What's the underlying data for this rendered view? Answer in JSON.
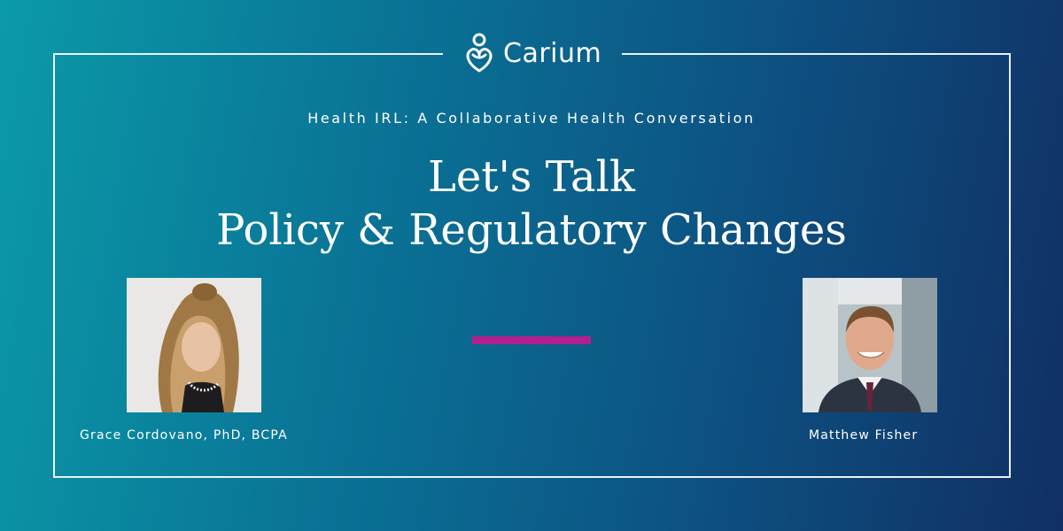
{
  "brand": {
    "name": "Carium",
    "icon": "carium-logo-icon"
  },
  "kicker": "Health IRL: A Collaborative Health Conversation",
  "headline": {
    "line1": "Let's Talk",
    "line2": "Policy & Regulatory Changes"
  },
  "speakers": [
    {
      "name": "Grace Cordovano, PhD, BCPA",
      "photo": "speaker-photo"
    },
    {
      "name": "Matthew Fisher",
      "photo": "speaker-photo"
    }
  ],
  "colors": {
    "gradient_start": "#0b9aa8",
    "gradient_end": "#112f63",
    "accent": "#b1208e",
    "text": "#ffffff"
  }
}
